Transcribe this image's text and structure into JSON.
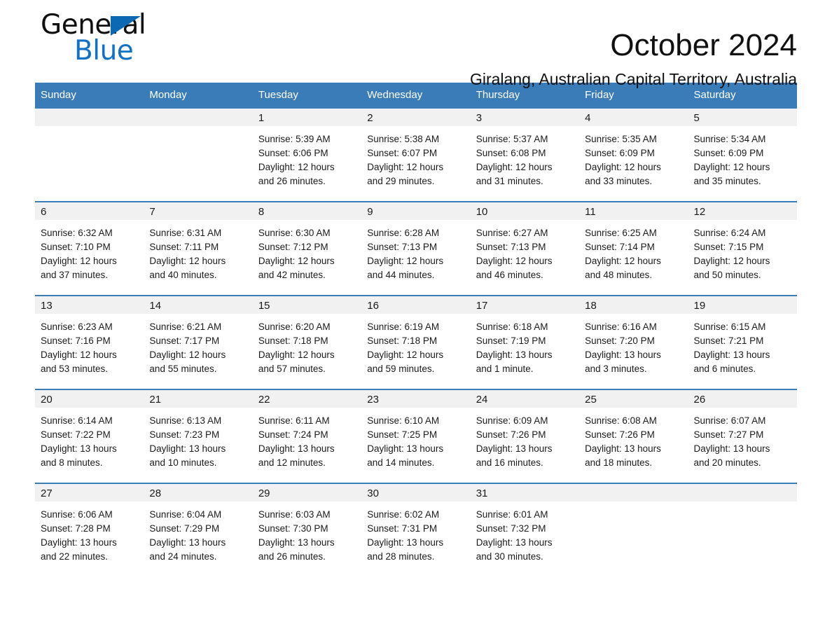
{
  "brand": {
    "name_part1": "General",
    "name_part2": "Blue",
    "accent_color": "#1271c4",
    "triangle_color": "#0b68b3"
  },
  "header": {
    "month_title": "October 2024",
    "location": "Giralang, Australian Capital Territory, Australia",
    "header_bg_color": "#3a7cb8",
    "row_divider_color": "#3a7cb8",
    "daynum_band_color": "#f1f1f1"
  },
  "weekday_headers": [
    "Sunday",
    "Monday",
    "Tuesday",
    "Wednesday",
    "Thursday",
    "Friday",
    "Saturday"
  ],
  "weeks": [
    [
      {
        "day": "",
        "sunrise": "",
        "sunset": "",
        "daylight_line1": "",
        "daylight_line2": ""
      },
      {
        "day": "",
        "sunrise": "",
        "sunset": "",
        "daylight_line1": "",
        "daylight_line2": ""
      },
      {
        "day": "1",
        "sunrise": "Sunrise: 5:39 AM",
        "sunset": "Sunset: 6:06 PM",
        "daylight_line1": "Daylight: 12 hours",
        "daylight_line2": "and 26 minutes."
      },
      {
        "day": "2",
        "sunrise": "Sunrise: 5:38 AM",
        "sunset": "Sunset: 6:07 PM",
        "daylight_line1": "Daylight: 12 hours",
        "daylight_line2": "and 29 minutes."
      },
      {
        "day": "3",
        "sunrise": "Sunrise: 5:37 AM",
        "sunset": "Sunset: 6:08 PM",
        "daylight_line1": "Daylight: 12 hours",
        "daylight_line2": "and 31 minutes."
      },
      {
        "day": "4",
        "sunrise": "Sunrise: 5:35 AM",
        "sunset": "Sunset: 6:09 PM",
        "daylight_line1": "Daylight: 12 hours",
        "daylight_line2": "and 33 minutes."
      },
      {
        "day": "5",
        "sunrise": "Sunrise: 5:34 AM",
        "sunset": "Sunset: 6:09 PM",
        "daylight_line1": "Daylight: 12 hours",
        "daylight_line2": "and 35 minutes."
      }
    ],
    [
      {
        "day": "6",
        "sunrise": "Sunrise: 6:32 AM",
        "sunset": "Sunset: 7:10 PM",
        "daylight_line1": "Daylight: 12 hours",
        "daylight_line2": "and 37 minutes."
      },
      {
        "day": "7",
        "sunrise": "Sunrise: 6:31 AM",
        "sunset": "Sunset: 7:11 PM",
        "daylight_line1": "Daylight: 12 hours",
        "daylight_line2": "and 40 minutes."
      },
      {
        "day": "8",
        "sunrise": "Sunrise: 6:30 AM",
        "sunset": "Sunset: 7:12 PM",
        "daylight_line1": "Daylight: 12 hours",
        "daylight_line2": "and 42 minutes."
      },
      {
        "day": "9",
        "sunrise": "Sunrise: 6:28 AM",
        "sunset": "Sunset: 7:13 PM",
        "daylight_line1": "Daylight: 12 hours",
        "daylight_line2": "and 44 minutes."
      },
      {
        "day": "10",
        "sunrise": "Sunrise: 6:27 AM",
        "sunset": "Sunset: 7:13 PM",
        "daylight_line1": "Daylight: 12 hours",
        "daylight_line2": "and 46 minutes."
      },
      {
        "day": "11",
        "sunrise": "Sunrise: 6:25 AM",
        "sunset": "Sunset: 7:14 PM",
        "daylight_line1": "Daylight: 12 hours",
        "daylight_line2": "and 48 minutes."
      },
      {
        "day": "12",
        "sunrise": "Sunrise: 6:24 AM",
        "sunset": "Sunset: 7:15 PM",
        "daylight_line1": "Daylight: 12 hours",
        "daylight_line2": "and 50 minutes."
      }
    ],
    [
      {
        "day": "13",
        "sunrise": "Sunrise: 6:23 AM",
        "sunset": "Sunset: 7:16 PM",
        "daylight_line1": "Daylight: 12 hours",
        "daylight_line2": "and 53 minutes."
      },
      {
        "day": "14",
        "sunrise": "Sunrise: 6:21 AM",
        "sunset": "Sunset: 7:17 PM",
        "daylight_line1": "Daylight: 12 hours",
        "daylight_line2": "and 55 minutes."
      },
      {
        "day": "15",
        "sunrise": "Sunrise: 6:20 AM",
        "sunset": "Sunset: 7:18 PM",
        "daylight_line1": "Daylight: 12 hours",
        "daylight_line2": "and 57 minutes."
      },
      {
        "day": "16",
        "sunrise": "Sunrise: 6:19 AM",
        "sunset": "Sunset: 7:18 PM",
        "daylight_line1": "Daylight: 12 hours",
        "daylight_line2": "and 59 minutes."
      },
      {
        "day": "17",
        "sunrise": "Sunrise: 6:18 AM",
        "sunset": "Sunset: 7:19 PM",
        "daylight_line1": "Daylight: 13 hours",
        "daylight_line2": "and 1 minute."
      },
      {
        "day": "18",
        "sunrise": "Sunrise: 6:16 AM",
        "sunset": "Sunset: 7:20 PM",
        "daylight_line1": "Daylight: 13 hours",
        "daylight_line2": "and 3 minutes."
      },
      {
        "day": "19",
        "sunrise": "Sunrise: 6:15 AM",
        "sunset": "Sunset: 7:21 PM",
        "daylight_line1": "Daylight: 13 hours",
        "daylight_line2": "and 6 minutes."
      }
    ],
    [
      {
        "day": "20",
        "sunrise": "Sunrise: 6:14 AM",
        "sunset": "Sunset: 7:22 PM",
        "daylight_line1": "Daylight: 13 hours",
        "daylight_line2": "and 8 minutes."
      },
      {
        "day": "21",
        "sunrise": "Sunrise: 6:13 AM",
        "sunset": "Sunset: 7:23 PM",
        "daylight_line1": "Daylight: 13 hours",
        "daylight_line2": "and 10 minutes."
      },
      {
        "day": "22",
        "sunrise": "Sunrise: 6:11 AM",
        "sunset": "Sunset: 7:24 PM",
        "daylight_line1": "Daylight: 13 hours",
        "daylight_line2": "and 12 minutes."
      },
      {
        "day": "23",
        "sunrise": "Sunrise: 6:10 AM",
        "sunset": "Sunset: 7:25 PM",
        "daylight_line1": "Daylight: 13 hours",
        "daylight_line2": "and 14 minutes."
      },
      {
        "day": "24",
        "sunrise": "Sunrise: 6:09 AM",
        "sunset": "Sunset: 7:26 PM",
        "daylight_line1": "Daylight: 13 hours",
        "daylight_line2": "and 16 minutes."
      },
      {
        "day": "25",
        "sunrise": "Sunrise: 6:08 AM",
        "sunset": "Sunset: 7:26 PM",
        "daylight_line1": "Daylight: 13 hours",
        "daylight_line2": "and 18 minutes."
      },
      {
        "day": "26",
        "sunrise": "Sunrise: 6:07 AM",
        "sunset": "Sunset: 7:27 PM",
        "daylight_line1": "Daylight: 13 hours",
        "daylight_line2": "and 20 minutes."
      }
    ],
    [
      {
        "day": "27",
        "sunrise": "Sunrise: 6:06 AM",
        "sunset": "Sunset: 7:28 PM",
        "daylight_line1": "Daylight: 13 hours",
        "daylight_line2": "and 22 minutes."
      },
      {
        "day": "28",
        "sunrise": "Sunrise: 6:04 AM",
        "sunset": "Sunset: 7:29 PM",
        "daylight_line1": "Daylight: 13 hours",
        "daylight_line2": "and 24 minutes."
      },
      {
        "day": "29",
        "sunrise": "Sunrise: 6:03 AM",
        "sunset": "Sunset: 7:30 PM",
        "daylight_line1": "Daylight: 13 hours",
        "daylight_line2": "and 26 minutes."
      },
      {
        "day": "30",
        "sunrise": "Sunrise: 6:02 AM",
        "sunset": "Sunset: 7:31 PM",
        "daylight_line1": "Daylight: 13 hours",
        "daylight_line2": "and 28 minutes."
      },
      {
        "day": "31",
        "sunrise": "Sunrise: 6:01 AM",
        "sunset": "Sunset: 7:32 PM",
        "daylight_line1": "Daylight: 13 hours",
        "daylight_line2": "and 30 minutes."
      },
      {
        "day": "",
        "sunrise": "",
        "sunset": "",
        "daylight_line1": "",
        "daylight_line2": ""
      },
      {
        "day": "",
        "sunrise": "",
        "sunset": "",
        "daylight_line1": "",
        "daylight_line2": ""
      }
    ]
  ]
}
